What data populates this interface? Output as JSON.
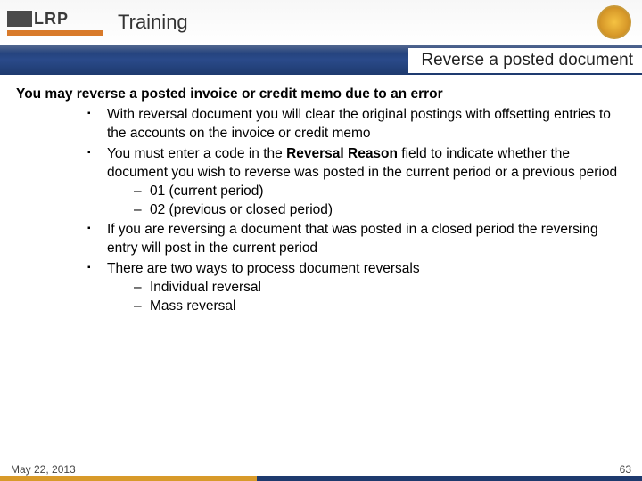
{
  "header": {
    "logo_text": "LRP",
    "title": "Training"
  },
  "subhead": "Reverse a posted document",
  "content": {
    "intro": "You may reverse a posted invoice or credit memo due to an error",
    "bullets": [
      "With reversal document you will clear the original postings with offsetting entries to the accounts on the invoice or credit memo",
      "",
      "If you are reversing a document that was posted in a closed period the reversing entry will post in the current period",
      "There are two ways to process document reversals"
    ],
    "bullet2_pre": "You must enter a code in the ",
    "bullet2_bold": "Reversal Reason",
    "bullet2_post": " field to indicate whether the document you wish to reverse was posted in the current period or a previous period",
    "codes": [
      "01 (current period)",
      "02 (previous or closed period)"
    ],
    "ways": [
      "Individual reversal",
      "Mass reversal"
    ]
  },
  "footer": {
    "date": "May 22, 2013",
    "page": "63"
  }
}
